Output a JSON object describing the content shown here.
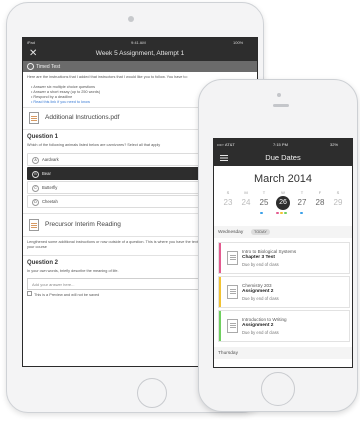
{
  "ipad": {
    "status": {
      "carrier": "iPad",
      "time": "9:41 AM",
      "battery": "100%"
    },
    "nav": {
      "title": "Week 5 Assignment, Attempt 1"
    },
    "timed_test": {
      "label": "Timed Test"
    },
    "instructions": "Here are the instructions that I added that instructors that I would like you to follow. You have to:",
    "bullets": [
      "Answer six multiple choice questions",
      "Answer a short essay (up to 250 words)",
      "Respond by a deadline",
      "Read this link if you need to know"
    ],
    "file1": "Additional Instructions.pdf",
    "question1": {
      "heading": "Question 1",
      "prompt": "Which of the following animals listed below are carnivores? Select all that apply",
      "options": [
        {
          "letter": "A",
          "label": "Aardvark",
          "selected": false
        },
        {
          "letter": "B",
          "label": "Bear",
          "selected": true
        },
        {
          "letter": "C",
          "label": "Butterfly",
          "selected": false
        },
        {
          "letter": "D",
          "label": "Cheetah",
          "selected": false
        }
      ]
    },
    "file2": "Precursor Interim Reading",
    "between_text": "Lengthened some additional instructions or now outside of a question. This is where you have the text for that you to tell them about your course",
    "question2": {
      "heading": "Question 2",
      "prompt": "In your own words, briefly describe the meaning of life.",
      "placeholder": "Add your answer here...",
      "footer": "This is a Preview and will not be saved"
    }
  },
  "iphone": {
    "status": {
      "carrier": "••••◦ AT&T",
      "time": "7:15 PM",
      "battery": "32%"
    },
    "nav": {
      "title": "Due Dates"
    },
    "calendar": {
      "month": "March 2014",
      "dow": [
        "S",
        "M",
        "T",
        "W",
        "T",
        "F",
        "S"
      ],
      "days": [
        "23",
        "24",
        "25",
        "26",
        "27",
        "28",
        "29"
      ],
      "today_index": 3
    },
    "section_wed": {
      "label": "Wednesday",
      "today_button": "TODAY"
    },
    "items": [
      {
        "course": "Intro to Biological Systems",
        "assignment": "Chapter 3 Test",
        "due": "Due by end of class",
        "color": "#e35a8f"
      },
      {
        "course": "Chemistry 203",
        "assignment": "Assignment 2",
        "due": "Due by end of class",
        "color": "#f1c232"
      },
      {
        "course": "Introduction to Writing",
        "assignment": "Assignment 2",
        "due": "Due by end of class",
        "color": "#6fcf5f"
      }
    ],
    "section_thu": {
      "label": "Thursday"
    }
  },
  "colors": {
    "dark_bar": "#2d2d2d",
    "pink": "#e35a8f",
    "yellow": "#f1c232",
    "green": "#6fcf5f",
    "blue": "#3aa0e8"
  }
}
